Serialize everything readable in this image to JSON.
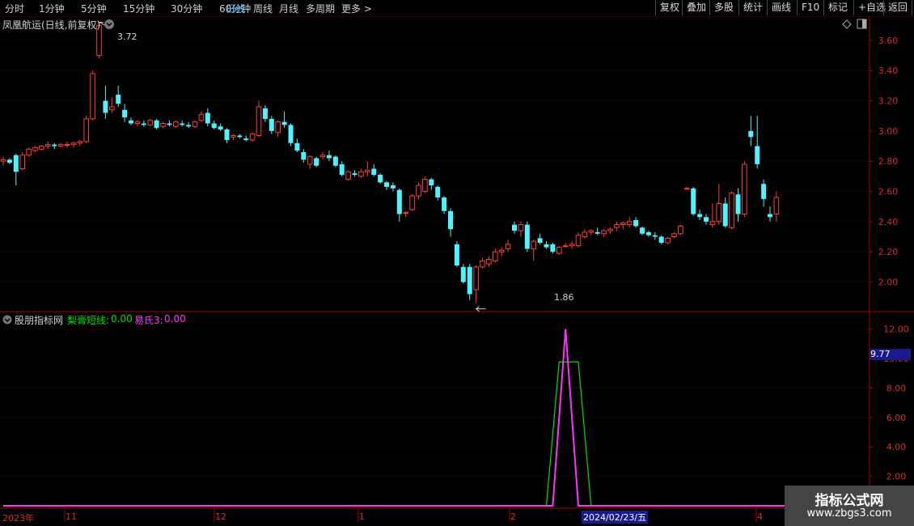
{
  "toolbar": {
    "timeframes": [
      "分时",
      "1分钟",
      "5分钟",
      "15分钟",
      "30分钟",
      "60分钟",
      "日线",
      "周线",
      "月线",
      "多周期",
      "更多 >"
    ],
    "active_timeframe": "日线",
    "buttons": [
      "复权",
      "叠加",
      "多股",
      "统计",
      "画线",
      "F10",
      "标记",
      "+自选",
      "返回"
    ]
  },
  "main_panel": {
    "title": "凤凰航运(日线,前复权)",
    "high_marker": "3.72",
    "low_marker": "1.86"
  },
  "indicator_panel": {
    "title": "股朋指标网",
    "line1_label": "梨膏短线:",
    "line1_value": "0.00",
    "line2_label": "易氏3:",
    "line2_value": "0.00",
    "current_value_tag": "9.77"
  },
  "time_axis": {
    "labels": [
      "2023年",
      "11",
      "12",
      "1",
      "2",
      "4"
    ],
    "cursor_date": "2024/02/23/五"
  },
  "watermark": {
    "title": "指标公式网",
    "url": "www.zbgs3.com"
  },
  "colors": {
    "up": "#ff3b3b",
    "down": "#4ff2ff",
    "line1": "#00e000",
    "line2": "#ff33ff",
    "axis": "#aa0000"
  },
  "chart_data": [
    {
      "type": "candlestick",
      "title": "凤凰航运(日线,前复权)",
      "y_ticks": [
        2.0,
        2.2,
        2.4,
        2.6,
        2.8,
        3.0,
        3.2,
        3.4,
        3.6
      ],
      "ylim": [
        1.81,
        3.76
      ],
      "grid": true,
      "candles": [
        {
          "o": 2.8,
          "h": 2.83,
          "l": 2.77,
          "c": 2.81
        },
        {
          "o": 2.81,
          "h": 2.82,
          "l": 2.78,
          "c": 2.79
        },
        {
          "o": 2.84,
          "h": 2.85,
          "l": 2.64,
          "c": 2.73
        },
        {
          "o": 2.75,
          "h": 2.86,
          "l": 2.74,
          "c": 2.84
        },
        {
          "o": 2.84,
          "h": 2.89,
          "l": 2.83,
          "c": 2.88
        },
        {
          "o": 2.87,
          "h": 2.9,
          "l": 2.86,
          "c": 2.89
        },
        {
          "o": 2.88,
          "h": 2.91,
          "l": 2.87,
          "c": 2.9
        },
        {
          "o": 2.9,
          "h": 2.93,
          "l": 2.88,
          "c": 2.91
        },
        {
          "o": 2.91,
          "h": 2.92,
          "l": 2.88,
          "c": 2.9
        },
        {
          "o": 2.9,
          "h": 2.92,
          "l": 2.89,
          "c": 2.91
        },
        {
          "o": 2.91,
          "h": 2.93,
          "l": 2.89,
          "c": 2.91
        },
        {
          "o": 2.91,
          "h": 2.93,
          "l": 2.89,
          "c": 2.92
        },
        {
          "o": 2.92,
          "h": 2.94,
          "l": 2.9,
          "c": 2.93
        },
        {
          "o": 2.93,
          "h": 3.1,
          "l": 2.92,
          "c": 3.08
        },
        {
          "o": 3.08,
          "h": 3.4,
          "l": 3.07,
          "c": 3.38
        },
        {
          "o": 3.5,
          "h": 3.72,
          "l": 3.48,
          "c": 3.7
        },
        {
          "o": 3.2,
          "h": 3.3,
          "l": 3.08,
          "c": 3.12
        },
        {
          "o": 3.14,
          "h": 3.22,
          "l": 3.12,
          "c": 3.16
        },
        {
          "o": 3.24,
          "h": 3.3,
          "l": 3.16,
          "c": 3.18
        },
        {
          "o": 3.14,
          "h": 3.18,
          "l": 3.06,
          "c": 3.09
        },
        {
          "o": 3.07,
          "h": 3.09,
          "l": 3.04,
          "c": 3.05
        },
        {
          "o": 3.05,
          "h": 3.07,
          "l": 3.03,
          "c": 3.06
        },
        {
          "o": 3.05,
          "h": 3.07,
          "l": 3.03,
          "c": 3.04
        },
        {
          "o": 3.04,
          "h": 3.08,
          "l": 3.03,
          "c": 3.07
        },
        {
          "o": 3.07,
          "h": 3.08,
          "l": 3.01,
          "c": 3.02
        },
        {
          "o": 3.03,
          "h": 3.06,
          "l": 3.02,
          "c": 3.05
        },
        {
          "o": 3.05,
          "h": 3.07,
          "l": 3.03,
          "c": 3.04
        },
        {
          "o": 3.03,
          "h": 3.07,
          "l": 3.02,
          "c": 3.06
        },
        {
          "o": 3.05,
          "h": 3.07,
          "l": 3.03,
          "c": 3.04
        },
        {
          "o": 3.04,
          "h": 3.06,
          "l": 3.02,
          "c": 3.03
        },
        {
          "o": 3.03,
          "h": 3.07,
          "l": 3.02,
          "c": 3.06
        },
        {
          "o": 3.07,
          "h": 3.13,
          "l": 3.06,
          "c": 3.11
        },
        {
          "o": 3.12,
          "h": 3.15,
          "l": 3.03,
          "c": 3.05
        },
        {
          "o": 3.05,
          "h": 3.07,
          "l": 3.01,
          "c": 3.02
        },
        {
          "o": 3.03,
          "h": 3.05,
          "l": 3.0,
          "c": 3.01
        },
        {
          "o": 3.01,
          "h": 3.02,
          "l": 2.92,
          "c": 2.94
        },
        {
          "o": 2.96,
          "h": 2.98,
          "l": 2.94,
          "c": 2.97
        },
        {
          "o": 2.97,
          "h": 2.98,
          "l": 2.95,
          "c": 2.96
        },
        {
          "o": 2.95,
          "h": 2.97,
          "l": 2.93,
          "c": 2.94
        },
        {
          "o": 2.94,
          "h": 2.99,
          "l": 2.93,
          "c": 2.98
        },
        {
          "o": 2.97,
          "h": 3.2,
          "l": 2.96,
          "c": 3.16
        },
        {
          "o": 3.15,
          "h": 3.17,
          "l": 3.06,
          "c": 3.08
        },
        {
          "o": 3.08,
          "h": 3.1,
          "l": 2.98,
          "c": 3.0
        },
        {
          "o": 2.99,
          "h": 3.07,
          "l": 2.96,
          "c": 3.06
        },
        {
          "o": 3.06,
          "h": 3.13,
          "l": 3.02,
          "c": 3.04
        },
        {
          "o": 3.04,
          "h": 3.05,
          "l": 2.9,
          "c": 2.92
        },
        {
          "o": 2.92,
          "h": 2.95,
          "l": 2.86,
          "c": 2.87
        },
        {
          "o": 2.86,
          "h": 2.88,
          "l": 2.79,
          "c": 2.81
        },
        {
          "o": 2.78,
          "h": 2.84,
          "l": 2.75,
          "c": 2.83
        },
        {
          "o": 2.82,
          "h": 2.83,
          "l": 2.76,
          "c": 2.77
        },
        {
          "o": 2.83,
          "h": 2.86,
          "l": 2.81,
          "c": 2.84
        },
        {
          "o": 2.84,
          "h": 2.87,
          "l": 2.8,
          "c": 2.82
        },
        {
          "o": 2.83,
          "h": 2.84,
          "l": 2.76,
          "c": 2.77
        },
        {
          "o": 2.78,
          "h": 2.8,
          "l": 2.7,
          "c": 2.71
        },
        {
          "o": 2.68,
          "h": 2.74,
          "l": 2.67,
          "c": 2.73
        },
        {
          "o": 2.72,
          "h": 2.74,
          "l": 2.7,
          "c": 2.71
        },
        {
          "o": 2.7,
          "h": 2.75,
          "l": 2.69,
          "c": 2.73
        },
        {
          "o": 2.73,
          "h": 2.8,
          "l": 2.7,
          "c": 2.74
        },
        {
          "o": 2.75,
          "h": 2.78,
          "l": 2.7,
          "c": 2.71
        },
        {
          "o": 2.71,
          "h": 2.72,
          "l": 2.65,
          "c": 2.66
        },
        {
          "o": 2.66,
          "h": 2.67,
          "l": 2.61,
          "c": 2.63
        },
        {
          "o": 2.64,
          "h": 2.66,
          "l": 2.6,
          "c": 2.62
        },
        {
          "o": 2.61,
          "h": 2.62,
          "l": 2.4,
          "c": 2.45
        },
        {
          "o": 2.46,
          "h": 2.47,
          "l": 2.43,
          "c": 2.46
        },
        {
          "o": 2.48,
          "h": 2.58,
          "l": 2.47,
          "c": 2.57
        },
        {
          "o": 2.57,
          "h": 2.66,
          "l": 2.55,
          "c": 2.64
        },
        {
          "o": 2.6,
          "h": 2.7,
          "l": 2.59,
          "c": 2.68
        },
        {
          "o": 2.68,
          "h": 2.69,
          "l": 2.61,
          "c": 2.64
        },
        {
          "o": 2.63,
          "h": 2.64,
          "l": 2.54,
          "c": 2.56
        },
        {
          "o": 2.56,
          "h": 2.57,
          "l": 2.45,
          "c": 2.47
        },
        {
          "o": 2.47,
          "h": 2.49,
          "l": 2.3,
          "c": 2.35
        },
        {
          "o": 2.25,
          "h": 2.27,
          "l": 2.1,
          "c": 2.11
        },
        {
          "o": 2.1,
          "h": 2.12,
          "l": 1.99,
          "c": 2.0
        },
        {
          "o": 2.1,
          "h": 2.12,
          "l": 1.88,
          "c": 1.92
        },
        {
          "o": 1.95,
          "h": 2.11,
          "l": 1.86,
          "c": 2.1
        },
        {
          "o": 2.1,
          "h": 2.16,
          "l": 2.09,
          "c": 2.14
        },
        {
          "o": 2.12,
          "h": 2.17,
          "l": 2.1,
          "c": 2.15
        },
        {
          "o": 2.14,
          "h": 2.22,
          "l": 2.13,
          "c": 2.2
        },
        {
          "o": 2.2,
          "h": 2.23,
          "l": 2.17,
          "c": 2.21
        },
        {
          "o": 2.22,
          "h": 2.28,
          "l": 2.2,
          "c": 2.25
        },
        {
          "o": 2.38,
          "h": 2.4,
          "l": 2.32,
          "c": 2.34
        },
        {
          "o": 2.34,
          "h": 2.4,
          "l": 2.3,
          "c": 2.38
        },
        {
          "o": 2.38,
          "h": 2.4,
          "l": 2.2,
          "c": 2.22
        },
        {
          "o": 2.22,
          "h": 2.28,
          "l": 2.14,
          "c": 2.27
        },
        {
          "o": 2.29,
          "h": 2.32,
          "l": 2.25,
          "c": 2.26
        },
        {
          "o": 2.25,
          "h": 2.27,
          "l": 2.22,
          "c": 2.23
        },
        {
          "o": 2.25,
          "h": 2.26,
          "l": 2.19,
          "c": 2.2
        },
        {
          "o": 2.19,
          "h": 2.24,
          "l": 2.18,
          "c": 2.23
        },
        {
          "o": 2.24,
          "h": 2.26,
          "l": 2.23,
          "c": 2.24
        },
        {
          "o": 2.24,
          "h": 2.27,
          "l": 2.22,
          "c": 2.25
        },
        {
          "o": 2.24,
          "h": 2.33,
          "l": 2.23,
          "c": 2.31
        },
        {
          "o": 2.3,
          "h": 2.35,
          "l": 2.29,
          "c": 2.33
        },
        {
          "o": 2.33,
          "h": 2.35,
          "l": 2.31,
          "c": 2.34
        },
        {
          "o": 2.33,
          "h": 2.36,
          "l": 2.31,
          "c": 2.32
        },
        {
          "o": 2.32,
          "h": 2.35,
          "l": 2.3,
          "c": 2.34
        },
        {
          "o": 2.34,
          "h": 2.36,
          "l": 2.32,
          "c": 2.35
        },
        {
          "o": 2.36,
          "h": 2.4,
          "l": 2.34,
          "c": 2.38
        },
        {
          "o": 2.38,
          "h": 2.4,
          "l": 2.35,
          "c": 2.39
        },
        {
          "o": 2.38,
          "h": 2.43,
          "l": 2.36,
          "c": 2.4
        },
        {
          "o": 2.41,
          "h": 2.43,
          "l": 2.36,
          "c": 2.37
        },
        {
          "o": 2.36,
          "h": 2.37,
          "l": 2.31,
          "c": 2.32
        },
        {
          "o": 2.33,
          "h": 2.34,
          "l": 2.3,
          "c": 2.31
        },
        {
          "o": 2.31,
          "h": 2.33,
          "l": 2.28,
          "c": 2.3
        },
        {
          "o": 2.3,
          "h": 2.31,
          "l": 2.25,
          "c": 2.26
        },
        {
          "o": 2.26,
          "h": 2.3,
          "l": 2.25,
          "c": 2.29
        },
        {
          "o": 2.3,
          "h": 2.33,
          "l": 2.29,
          "c": 2.32
        },
        {
          "o": 2.32,
          "h": 2.38,
          "l": 2.31,
          "c": 2.37
        },
        {
          "o": 2.62,
          "h": 2.63,
          "l": 2.62,
          "c": 2.62
        },
        {
          "o": 2.62,
          "h": 2.63,
          "l": 2.44,
          "c": 2.45
        },
        {
          "o": 2.45,
          "h": 2.48,
          "l": 2.41,
          "c": 2.43
        },
        {
          "o": 2.43,
          "h": 2.45,
          "l": 2.38,
          "c": 2.4
        },
        {
          "o": 2.38,
          "h": 2.52,
          "l": 2.36,
          "c": 2.4
        },
        {
          "o": 2.4,
          "h": 2.65,
          "l": 2.38,
          "c": 2.52
        },
        {
          "o": 2.52,
          "h": 2.56,
          "l": 2.36,
          "c": 2.37
        },
        {
          "o": 2.36,
          "h": 2.6,
          "l": 2.35,
          "c": 2.59
        },
        {
          "o": 2.58,
          "h": 2.62,
          "l": 2.4,
          "c": 2.45
        },
        {
          "o": 2.45,
          "h": 2.8,
          "l": 2.43,
          "c": 2.78
        },
        {
          "o": 3.0,
          "h": 3.1,
          "l": 2.9,
          "c": 2.96
        },
        {
          "o": 2.9,
          "h": 3.1,
          "l": 2.75,
          "c": 2.78
        },
        {
          "o": 2.65,
          "h": 2.68,
          "l": 2.5,
          "c": 2.55
        },
        {
          "o": 2.45,
          "h": 2.5,
          "l": 2.4,
          "c": 2.43
        },
        {
          "o": 2.45,
          "h": 2.6,
          "l": 2.4,
          "c": 2.56
        }
      ]
    },
    {
      "type": "line",
      "title": "股朋指标网",
      "y_ticks": [
        2.0,
        4.0,
        6.0,
        8.0,
        10.0,
        12.0
      ],
      "ylim": [
        0,
        12.2
      ],
      "series": [
        {
          "name": "梨膏短线",
          "points": [
            [
              0,
              0
            ],
            [
              85,
              0
            ],
            [
              87,
              9.77
            ],
            [
              90,
              9.77
            ],
            [
              92,
              0
            ],
            [
              134,
              0
            ]
          ]
        },
        {
          "name": "易氏3",
          "points": [
            [
              0,
              0
            ],
            [
              86,
              0
            ],
            [
              88,
              12.0
            ],
            [
              90,
              0
            ],
            [
              134,
              0
            ]
          ]
        }
      ]
    }
  ]
}
